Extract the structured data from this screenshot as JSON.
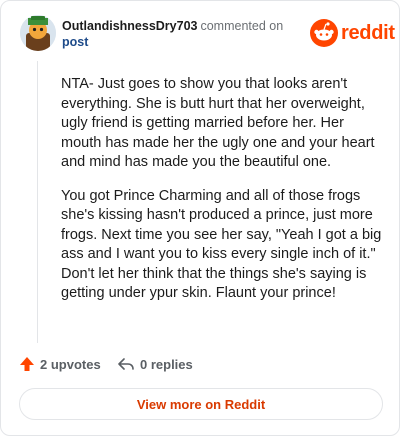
{
  "comment": {
    "author": "OutlandishnessDry703",
    "action_text": "commented on",
    "post_link": "post",
    "avatar_icon": "snoo-avatar-icon",
    "paragraphs": [
      "NTA- Just goes to show you that looks aren't everything. She is butt hurt that her overweight, ugly friend is getting married before her. Her mouth has made her the ugly one and your heart and mind has made you the beautiful one.",
      "You got Prince Charming and all of those frogs she's kissing hasn't produced a prince, just more frogs. Next time you see her say, \"Yeah I got a big ass and I want you to kiss every single inch of it.\" Don't let her think that the things she's saying is getting under ypur skin. Flaunt your prince!"
    ]
  },
  "brand": {
    "name": "reddit",
    "color": "#ff4500"
  },
  "actions": {
    "upvotes": "2 upvotes",
    "replies": "0 replies",
    "upvote_icon": "upvote-arrow-icon",
    "reply_icon": "reply-arrow-icon"
  },
  "footer": {
    "view_more": "View more on Reddit",
    "link_color": "#d93a00"
  }
}
